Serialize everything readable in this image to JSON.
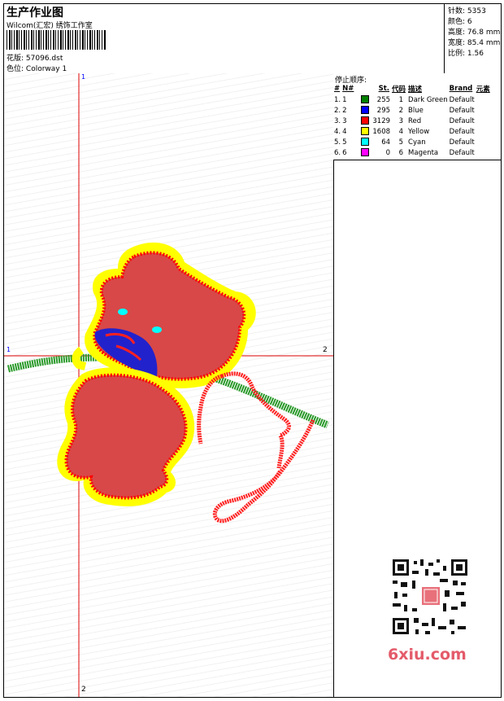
{
  "header": {
    "title": "生产作业图",
    "subtitle": "Wilcom(汇宏) 绣饰工作室",
    "design_label": "花版:",
    "design_value": "57096.dst",
    "colorway_label": "色位:",
    "colorway_value": "Colorway 1"
  },
  "stats": [
    {
      "label": "针数:",
      "value": "5353"
    },
    {
      "label": "颜色:",
      "value": "6"
    },
    {
      "label": "高度:",
      "value": "76.8 mm"
    },
    {
      "label": "宽度:",
      "value": "85.4 mm"
    },
    {
      "label": "比例:",
      "value": "1.56"
    }
  ],
  "stop_sequence": {
    "title": "停止顺序:",
    "headers": [
      "#",
      "N#",
      "",
      "St.",
      "代码",
      "描述",
      "Brand",
      "元素"
    ],
    "rows": [
      {
        "idx": "1.",
        "n": "1",
        "color": "#008000",
        "st": "255",
        "code": "1",
        "desc": "Dark Green",
        "brand": "Default"
      },
      {
        "idx": "2.",
        "n": "2",
        "color": "#0000ff",
        "st": "295",
        "code": "2",
        "desc": "Blue",
        "brand": "Default"
      },
      {
        "idx": "3.",
        "n": "3",
        "color": "#ff0000",
        "st": "3129",
        "code": "3",
        "desc": "Red",
        "brand": "Default"
      },
      {
        "idx": "4.",
        "n": "4",
        "color": "#ffff00",
        "st": "1608",
        "code": "4",
        "desc": "Yellow",
        "brand": "Default"
      },
      {
        "idx": "5.",
        "n": "5",
        "color": "#00ffff",
        "st": "64",
        "code": "5",
        "desc": "Cyan",
        "brand": "Default"
      },
      {
        "idx": "6.",
        "n": "6",
        "color": "#ff00ff",
        "st": "0",
        "code": "6",
        "desc": "Magenta",
        "brand": "Default"
      }
    ]
  },
  "axes": {
    "top": "1",
    "bottom": "2",
    "left": "1",
    "right": "2"
  },
  "watermark": {
    "site": "6xiu.com"
  }
}
